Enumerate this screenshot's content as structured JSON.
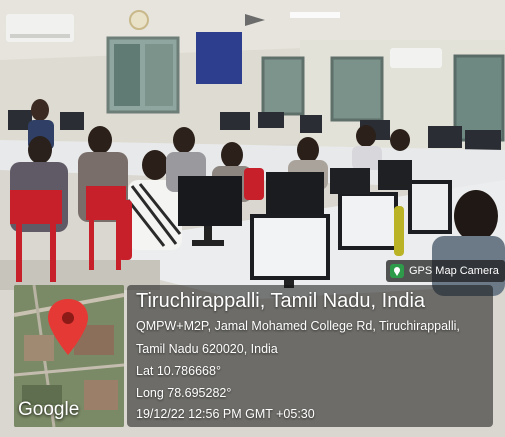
{
  "gps_overlay": {
    "badge_label": "GPS Map Camera",
    "title": "Tiruchirappalli, Tamil Nadu, India",
    "address_line1": "QMPW+M2P, Jamal Mohamed College Rd, Tiruchirappalli,",
    "address_line2": "Tamil Nadu 620020, India",
    "latitude": "Lat 10.786668°",
    "longitude": "Long 78.695282°",
    "datetime": "19/12/22 12:56 PM GMT +05:30"
  },
  "map_thumbnail": {
    "logo_text": "Google",
    "pin_color": "#e53935"
  },
  "scene": {
    "description_subject": "computer lab with students seated at rows of monitors"
  }
}
